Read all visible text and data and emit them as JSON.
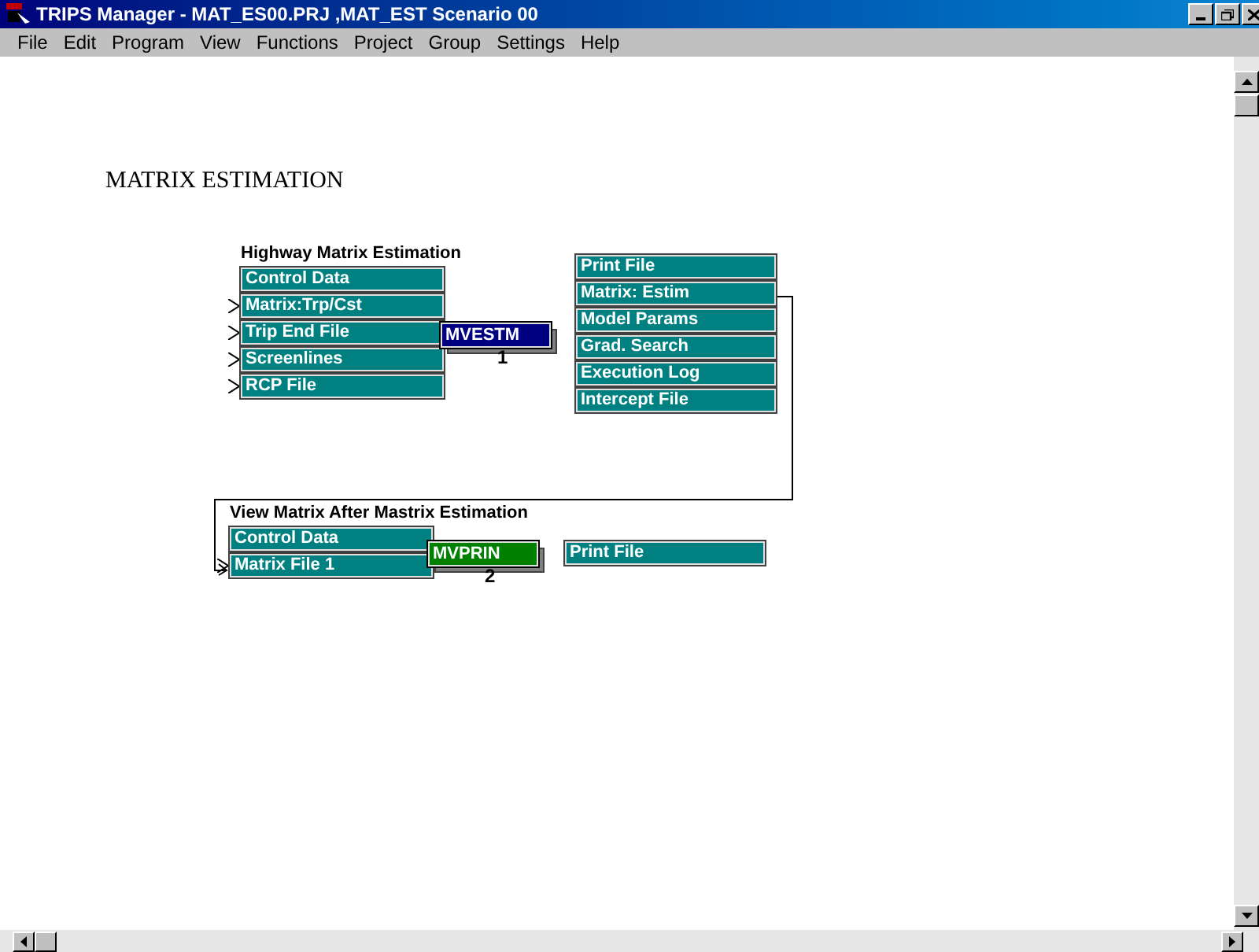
{
  "window": {
    "title": "TRIPS Manager - MAT_ES00.PRJ ,MAT_EST Scenario 00"
  },
  "menu": [
    {
      "label": "File"
    },
    {
      "label": "Edit"
    },
    {
      "label": "Program"
    },
    {
      "label": "View"
    },
    {
      "label": "Functions"
    },
    {
      "label": "Project"
    },
    {
      "label": "Group"
    },
    {
      "label": "Settings"
    },
    {
      "label": "Help"
    }
  ],
  "canvas": {
    "heading": "MATRIX ESTIMATION",
    "groups": [
      {
        "title": "Highway Matrix Estimation",
        "inputs": [
          {
            "label": "Control Data",
            "linked": false
          },
          {
            "label": "Matrix:Trp/Cst",
            "linked": true
          },
          {
            "label": "Trip End File",
            "linked": true
          },
          {
            "label": "Screenlines",
            "linked": true
          },
          {
            "label": "RCP File",
            "linked": true
          }
        ],
        "program": {
          "name": "MVESTM",
          "number": "1",
          "color": "#000080"
        },
        "outputs": [
          "Print File",
          "Matrix: Estim",
          "Model Params",
          "Grad. Search",
          "Execution Log",
          "Intercept File"
        ]
      },
      {
        "title": "View Matrix After Mastrix Estimation",
        "inputs": [
          {
            "label": "Control Data",
            "linked": false
          },
          {
            "label": "Matrix File 1",
            "linked": true
          }
        ],
        "program": {
          "name": "MVPRIN",
          "number": "2",
          "color": "#008000"
        },
        "outputs": [
          "Print File"
        ]
      }
    ]
  }
}
